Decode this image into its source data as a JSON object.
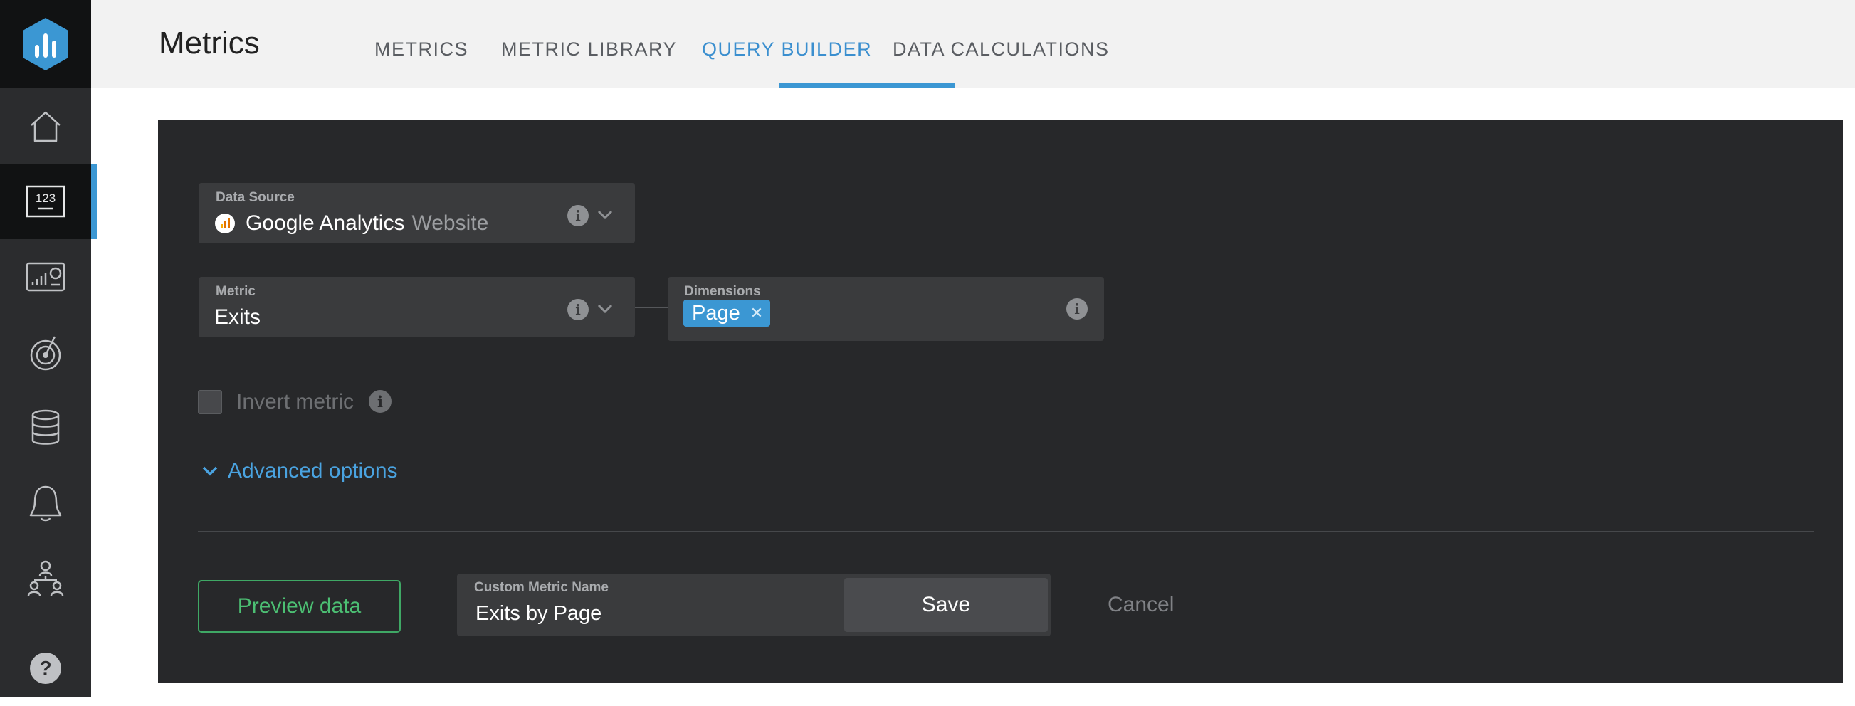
{
  "header": {
    "title": "Metrics",
    "tabs": [
      {
        "label": "METRICS"
      },
      {
        "label": "METRIC LIBRARY"
      },
      {
        "label": "QUERY BUILDER"
      },
      {
        "label": "DATA CALCULATIONS"
      }
    ],
    "active_tab": "QUERY BUILDER"
  },
  "sidebar": {
    "items": [
      {
        "icon": "home-icon"
      },
      {
        "icon": "metrics-123-icon",
        "label": "123",
        "active": true
      },
      {
        "icon": "dashboard-icon"
      },
      {
        "icon": "goals-target-icon"
      },
      {
        "icon": "data-stack-icon"
      },
      {
        "icon": "alerts-bell-icon"
      },
      {
        "icon": "team-icon"
      },
      {
        "icon": "help-icon",
        "label": "?"
      }
    ]
  },
  "form": {
    "data_source": {
      "label": "Data Source",
      "value": "Google Analytics",
      "sub": "Website"
    },
    "metric": {
      "label": "Metric",
      "value": "Exits"
    },
    "dimensions": {
      "label": "Dimensions",
      "chips": [
        {
          "label": "Page"
        }
      ]
    },
    "invert": {
      "label": "Invert metric",
      "checked": false
    },
    "advanced": {
      "label": "Advanced options"
    },
    "preview_button": "Preview data",
    "custom_name": {
      "label": "Custom Metric Name",
      "value": "Exits by Page"
    },
    "save_button": "Save",
    "cancel_button": "Cancel"
  },
  "colors": {
    "accent": "#3b97d3",
    "panel": "#27282a",
    "sidebar": "#2b2c2e",
    "preview": "#4cbf73"
  }
}
